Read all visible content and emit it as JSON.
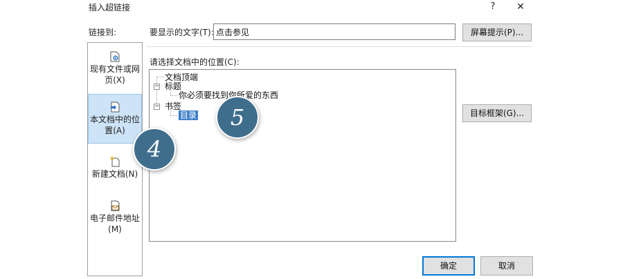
{
  "dialog": {
    "title": "插入超链接",
    "help_label": "?",
    "close_label": "✕"
  },
  "sidebar": {
    "heading": "链接到:",
    "items": [
      {
        "line1": "现有文件或网",
        "line2": "页(X)",
        "icon": "existing-file-icon"
      },
      {
        "line1": "本文档中的位",
        "line2": "置(A)",
        "icon": "place-in-document-icon",
        "selected": true
      },
      {
        "line1": "新建文档(N)",
        "line2": "",
        "icon": "new-document-icon"
      },
      {
        "line1": "电子邮件地址",
        "line2": "(M)",
        "icon": "email-address-icon"
      }
    ]
  },
  "display": {
    "label": "要显示的文字(T):",
    "value": "点击参见"
  },
  "buttons": {
    "screentip": "屏幕提示(P)...",
    "target_frame": "目标框架(G)...",
    "ok": "确定",
    "cancel": "取消"
  },
  "place": {
    "label": "请选择文档中的位置(C):",
    "tree": {
      "top": "文档顶端",
      "headings": "标题",
      "heading_child": "你必须要找到你所爱的东西",
      "bookmarks": "书签",
      "bookmark_child": "目录"
    }
  },
  "callouts": {
    "first": "4",
    "second": "5"
  },
  "colors": {
    "callout": "#3f6d8c",
    "selection": "#3c7ec9",
    "sidebar_selected": "#cde3f7",
    "default_button_border": "#0078d7"
  }
}
